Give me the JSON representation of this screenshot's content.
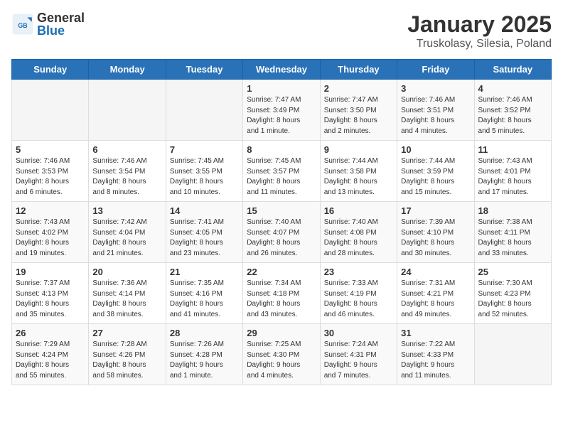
{
  "header": {
    "logo": {
      "general": "General",
      "blue": "Blue"
    },
    "title": "January 2025",
    "subtitle": "Truskolasy, Silesia, Poland"
  },
  "calendar": {
    "days_of_week": [
      "Sunday",
      "Monday",
      "Tuesday",
      "Wednesday",
      "Thursday",
      "Friday",
      "Saturday"
    ],
    "weeks": [
      [
        {
          "day": "",
          "info": ""
        },
        {
          "day": "",
          "info": ""
        },
        {
          "day": "",
          "info": ""
        },
        {
          "day": "1",
          "info": "Sunrise: 7:47 AM\nSunset: 3:49 PM\nDaylight: 8 hours\nand 1 minute."
        },
        {
          "day": "2",
          "info": "Sunrise: 7:47 AM\nSunset: 3:50 PM\nDaylight: 8 hours\nand 2 minutes."
        },
        {
          "day": "3",
          "info": "Sunrise: 7:46 AM\nSunset: 3:51 PM\nDaylight: 8 hours\nand 4 minutes."
        },
        {
          "day": "4",
          "info": "Sunrise: 7:46 AM\nSunset: 3:52 PM\nDaylight: 8 hours\nand 5 minutes."
        }
      ],
      [
        {
          "day": "5",
          "info": "Sunrise: 7:46 AM\nSunset: 3:53 PM\nDaylight: 8 hours\nand 6 minutes."
        },
        {
          "day": "6",
          "info": "Sunrise: 7:46 AM\nSunset: 3:54 PM\nDaylight: 8 hours\nand 8 minutes."
        },
        {
          "day": "7",
          "info": "Sunrise: 7:45 AM\nSunset: 3:55 PM\nDaylight: 8 hours\nand 10 minutes."
        },
        {
          "day": "8",
          "info": "Sunrise: 7:45 AM\nSunset: 3:57 PM\nDaylight: 8 hours\nand 11 minutes."
        },
        {
          "day": "9",
          "info": "Sunrise: 7:44 AM\nSunset: 3:58 PM\nDaylight: 8 hours\nand 13 minutes."
        },
        {
          "day": "10",
          "info": "Sunrise: 7:44 AM\nSunset: 3:59 PM\nDaylight: 8 hours\nand 15 minutes."
        },
        {
          "day": "11",
          "info": "Sunrise: 7:43 AM\nSunset: 4:01 PM\nDaylight: 8 hours\nand 17 minutes."
        }
      ],
      [
        {
          "day": "12",
          "info": "Sunrise: 7:43 AM\nSunset: 4:02 PM\nDaylight: 8 hours\nand 19 minutes."
        },
        {
          "day": "13",
          "info": "Sunrise: 7:42 AM\nSunset: 4:04 PM\nDaylight: 8 hours\nand 21 minutes."
        },
        {
          "day": "14",
          "info": "Sunrise: 7:41 AM\nSunset: 4:05 PM\nDaylight: 8 hours\nand 23 minutes."
        },
        {
          "day": "15",
          "info": "Sunrise: 7:40 AM\nSunset: 4:07 PM\nDaylight: 8 hours\nand 26 minutes."
        },
        {
          "day": "16",
          "info": "Sunrise: 7:40 AM\nSunset: 4:08 PM\nDaylight: 8 hours\nand 28 minutes."
        },
        {
          "day": "17",
          "info": "Sunrise: 7:39 AM\nSunset: 4:10 PM\nDaylight: 8 hours\nand 30 minutes."
        },
        {
          "day": "18",
          "info": "Sunrise: 7:38 AM\nSunset: 4:11 PM\nDaylight: 8 hours\nand 33 minutes."
        }
      ],
      [
        {
          "day": "19",
          "info": "Sunrise: 7:37 AM\nSunset: 4:13 PM\nDaylight: 8 hours\nand 35 minutes."
        },
        {
          "day": "20",
          "info": "Sunrise: 7:36 AM\nSunset: 4:14 PM\nDaylight: 8 hours\nand 38 minutes."
        },
        {
          "day": "21",
          "info": "Sunrise: 7:35 AM\nSunset: 4:16 PM\nDaylight: 8 hours\nand 41 minutes."
        },
        {
          "day": "22",
          "info": "Sunrise: 7:34 AM\nSunset: 4:18 PM\nDaylight: 8 hours\nand 43 minutes."
        },
        {
          "day": "23",
          "info": "Sunrise: 7:33 AM\nSunset: 4:19 PM\nDaylight: 8 hours\nand 46 minutes."
        },
        {
          "day": "24",
          "info": "Sunrise: 7:31 AM\nSunset: 4:21 PM\nDaylight: 8 hours\nand 49 minutes."
        },
        {
          "day": "25",
          "info": "Sunrise: 7:30 AM\nSunset: 4:23 PM\nDaylight: 8 hours\nand 52 minutes."
        }
      ],
      [
        {
          "day": "26",
          "info": "Sunrise: 7:29 AM\nSunset: 4:24 PM\nDaylight: 8 hours\nand 55 minutes."
        },
        {
          "day": "27",
          "info": "Sunrise: 7:28 AM\nSunset: 4:26 PM\nDaylight: 8 hours\nand 58 minutes."
        },
        {
          "day": "28",
          "info": "Sunrise: 7:26 AM\nSunset: 4:28 PM\nDaylight: 9 hours\nand 1 minute."
        },
        {
          "day": "29",
          "info": "Sunrise: 7:25 AM\nSunset: 4:30 PM\nDaylight: 9 hours\nand 4 minutes."
        },
        {
          "day": "30",
          "info": "Sunrise: 7:24 AM\nSunset: 4:31 PM\nDaylight: 9 hours\nand 7 minutes."
        },
        {
          "day": "31",
          "info": "Sunrise: 7:22 AM\nSunset: 4:33 PM\nDaylight: 9 hours\nand 11 minutes."
        },
        {
          "day": "",
          "info": ""
        }
      ]
    ]
  }
}
